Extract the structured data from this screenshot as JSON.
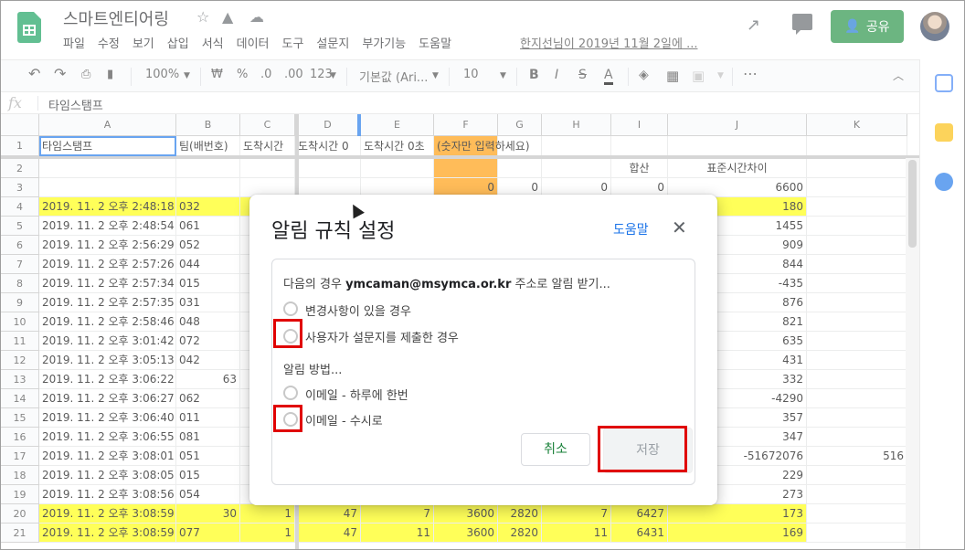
{
  "app": {
    "title": "스마트엔티어링",
    "menu": [
      "파일",
      "수정",
      "보기",
      "삽입",
      "서식",
      "데이터",
      "도구",
      "설문지",
      "부가기능",
      "도움말"
    ],
    "last_edit": "한지선님이 2019년 11월 2일에 ...",
    "share_label": "공유"
  },
  "toolbar": {
    "zoom": "100%",
    "currency": "₩",
    "percent": "%",
    "dec_less": ".0",
    "dec_more": ".00",
    "format": "123",
    "font": "기본값 (Ari...",
    "font_size": "10",
    "bold": "B",
    "italic": "I",
    "strike": "S",
    "text_color": "A",
    "more": "⋯"
  },
  "formula_bar": {
    "fx": "fx",
    "value": "타임스탬프"
  },
  "columns": [
    "A",
    "B",
    "C",
    "D",
    "E",
    "F",
    "G",
    "H",
    "I",
    "J",
    "K"
  ],
  "rows": [
    {
      "n": "1",
      "cells": [
        "타임스탬프",
        "팀(배번호)",
        "도착시간",
        "도착시간 0",
        "도착시간 0초",
        "(숫자만 입력하세요)",
        "",
        "",
        "",
        "",
        ""
      ]
    },
    {
      "n": "2",
      "cells": [
        "",
        "",
        "",
        "",
        "",
        "",
        "",
        "",
        "합산",
        "표준시간차이",
        ""
      ]
    },
    {
      "n": "3",
      "cells": [
        "",
        "",
        "",
        "",
        "",
        "0",
        "0",
        "0",
        "0",
        "6600",
        ""
      ]
    },
    {
      "n": "4",
      "cells": [
        "2019. 11. 2 오후 2:48:18",
        "032",
        "",
        "",
        "",
        "",
        "",
        "",
        "",
        "180",
        ""
      ]
    },
    {
      "n": "5",
      "cells": [
        "2019. 11. 2 오후 2:48:54",
        "061",
        "",
        "",
        "",
        "",
        "",
        "",
        "",
        "1455",
        ""
      ]
    },
    {
      "n": "6",
      "cells": [
        "2019. 11. 2 오후 2:56:29",
        "052",
        "",
        "",
        "",
        "",
        "",
        "",
        "",
        "909",
        ""
      ]
    },
    {
      "n": "7",
      "cells": [
        "2019. 11. 2 오후 2:57:26",
        "044",
        "",
        "",
        "",
        "",
        "",
        "",
        "",
        "844",
        ""
      ]
    },
    {
      "n": "8",
      "cells": [
        "2019. 11. 2 오후 2:57:34",
        "015",
        "",
        "",
        "",
        "",
        "",
        "",
        "",
        "-435",
        ""
      ]
    },
    {
      "n": "9",
      "cells": [
        "2019. 11. 2 오후 2:57:35",
        "031",
        "",
        "",
        "",
        "",
        "",
        "",
        "",
        "876",
        ""
      ]
    },
    {
      "n": "10",
      "cells": [
        "2019. 11. 2 오후 2:58:46",
        "048",
        "",
        "",
        "",
        "",
        "",
        "",
        "",
        "821",
        ""
      ]
    },
    {
      "n": "11",
      "cells": [
        "2019. 11. 2 오후 3:01:42",
        "072",
        "",
        "",
        "",
        "",
        "",
        "",
        "",
        "635",
        ""
      ]
    },
    {
      "n": "12",
      "cells": [
        "2019. 11. 2 오후 3:05:13",
        "042",
        "",
        "",
        "",
        "",
        "",
        "",
        "",
        "431",
        ""
      ]
    },
    {
      "n": "13",
      "cells": [
        "2019. 11. 2 오후 3:06:22",
        "63",
        "",
        "",
        "",
        "",
        "",
        "",
        "",
        "332",
        ""
      ]
    },
    {
      "n": "14",
      "cells": [
        "2019. 11. 2 오후 3:06:27",
        "062",
        "",
        "",
        "",
        "",
        "",
        "",
        "",
        "-4290",
        ""
      ]
    },
    {
      "n": "15",
      "cells": [
        "2019. 11. 2 오후 3:06:40",
        "011",
        "",
        "",
        "",
        "",
        "",
        "",
        "",
        "357",
        ""
      ]
    },
    {
      "n": "16",
      "cells": [
        "2019. 11. 2 오후 3:06:55",
        "081",
        "",
        "",
        "",
        "",
        "",
        "",
        "",
        "347",
        ""
      ]
    },
    {
      "n": "17",
      "cells": [
        "2019. 11. 2 오후 3:08:01",
        "051",
        "",
        "",
        "",
        "",
        "",
        "",
        "",
        "-51672076",
        "516"
      ]
    },
    {
      "n": "18",
      "cells": [
        "2019. 11. 2 오후 3:08:05",
        "015",
        "",
        "",
        "",
        "",
        "",
        "",
        "",
        "229",
        ""
      ]
    },
    {
      "n": "19",
      "cells": [
        "2019. 11. 2 오후 3:08:56",
        "054",
        "",
        "",
        "",
        "",
        "",
        "",
        "",
        "273",
        ""
      ]
    },
    {
      "n": "20",
      "cells": [
        "2019. 11. 2 오후 3:08:59",
        "30",
        "1",
        "47",
        "7",
        "3600",
        "2820",
        "7",
        "6427",
        "173",
        ""
      ]
    },
    {
      "n": "21",
      "cells": [
        "2019. 11. 2 오후 3:08:59",
        "077",
        "1",
        "47",
        "11",
        "3600",
        "2820",
        "11",
        "6431",
        "169",
        ""
      ]
    }
  ],
  "dialog": {
    "title": "알림 규칙 설정",
    "help": "도움말",
    "close": "✕",
    "notify_prefix": "다음의 경우",
    "notify_email": "ymcaman@msymca.or.kr",
    "notify_suffix": "주소로 알림 받기...",
    "option_changes": "변경사항이 있을 경우",
    "option_form": "사용자가 설문지를 제출한 경우",
    "method_label": "알림 방법...",
    "method_daily": "이메일 - 하루에 한번",
    "method_instant": "이메일 - 수시로",
    "cancel": "취소",
    "save": "저장"
  },
  "colors": {
    "highlight_yellow": "#ffff00",
    "highlight_orange": "#ff9900",
    "share_green": "#1e8e3e",
    "annotation_red": "#e00000"
  }
}
